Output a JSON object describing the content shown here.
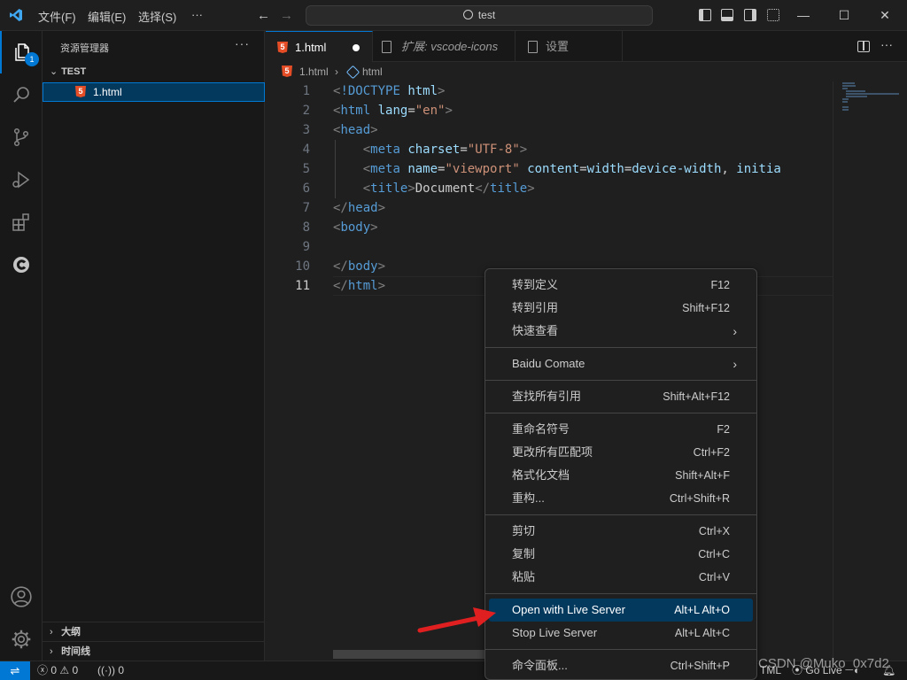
{
  "titlebar": {
    "menus": [
      "文件(F)",
      "编辑(E)",
      "选择(S)",
      "···"
    ],
    "command_center": "test",
    "colors": {
      "accent": "#0078d4"
    }
  },
  "activitybar": {
    "explorer_badge": "1",
    "icons": [
      "files-icon",
      "search-icon",
      "source-control-icon",
      "run-debug-icon",
      "extensions-icon",
      "comate-icon",
      "account-icon",
      "settings-gear-icon"
    ]
  },
  "sidebar": {
    "title": "资源管理器",
    "more": "···",
    "folder": "TEST",
    "files": [
      "1.html"
    ],
    "outline": "大纲",
    "timeline": "时间线"
  },
  "tabs": [
    {
      "label": "1.html",
      "active": true,
      "dirty": true
    },
    {
      "label": "扩展: vscode-icons",
      "active": false
    },
    {
      "label": "设置",
      "active": false
    }
  ],
  "breadcrumb": {
    "file": "1.html",
    "symbol": "html"
  },
  "editor": {
    "line_numbers": [
      "1",
      "2",
      "3",
      "4",
      "5",
      "6",
      "7",
      "8",
      "9",
      "10",
      "11"
    ],
    "active_line": 11,
    "lines": [
      "<!DOCTYPE html>",
      "<html lang=\"en\">",
      "<head>",
      "    <meta charset=\"UTF-8\">",
      "    <meta name=\"viewport\" content=\"width=device-width, initia",
      "    <title>Document</title>",
      "</head>",
      "<body>",
      "",
      "</body>",
      "</html>"
    ]
  },
  "context_menu": {
    "groups": [
      [
        {
          "label": "转到定义",
          "key": "F12"
        },
        {
          "label": "转到引用",
          "key": "Shift+F12"
        },
        {
          "label": "快速查看",
          "submenu": true
        }
      ],
      [
        {
          "label": "Baidu Comate",
          "submenu": true
        }
      ],
      [
        {
          "label": "查找所有引用",
          "key": "Shift+Alt+F12"
        }
      ],
      [
        {
          "label": "重命名符号",
          "key": "F2"
        },
        {
          "label": "更改所有匹配项",
          "key": "Ctrl+F2"
        },
        {
          "label": "格式化文档",
          "key": "Shift+Alt+F"
        },
        {
          "label": "重构...",
          "key": "Ctrl+Shift+R"
        }
      ],
      [
        {
          "label": "剪切",
          "key": "Ctrl+X"
        },
        {
          "label": "复制",
          "key": "Ctrl+C"
        },
        {
          "label": "粘贴",
          "key": "Ctrl+V"
        }
      ],
      [
        {
          "label": "Open with Live Server",
          "key": "Alt+L Alt+O",
          "highlighted": true
        },
        {
          "label": "Stop Live Server",
          "key": "Alt+L Alt+C"
        }
      ],
      [
        {
          "label": "命令面板...",
          "key": "Ctrl+Shift+P"
        }
      ]
    ]
  },
  "statusbar": {
    "errors": "0",
    "warnings": "0",
    "ports": "0",
    "language": "TML",
    "go_live": "Go Live"
  },
  "watermark": "CSDN @Muko_0x7d2"
}
